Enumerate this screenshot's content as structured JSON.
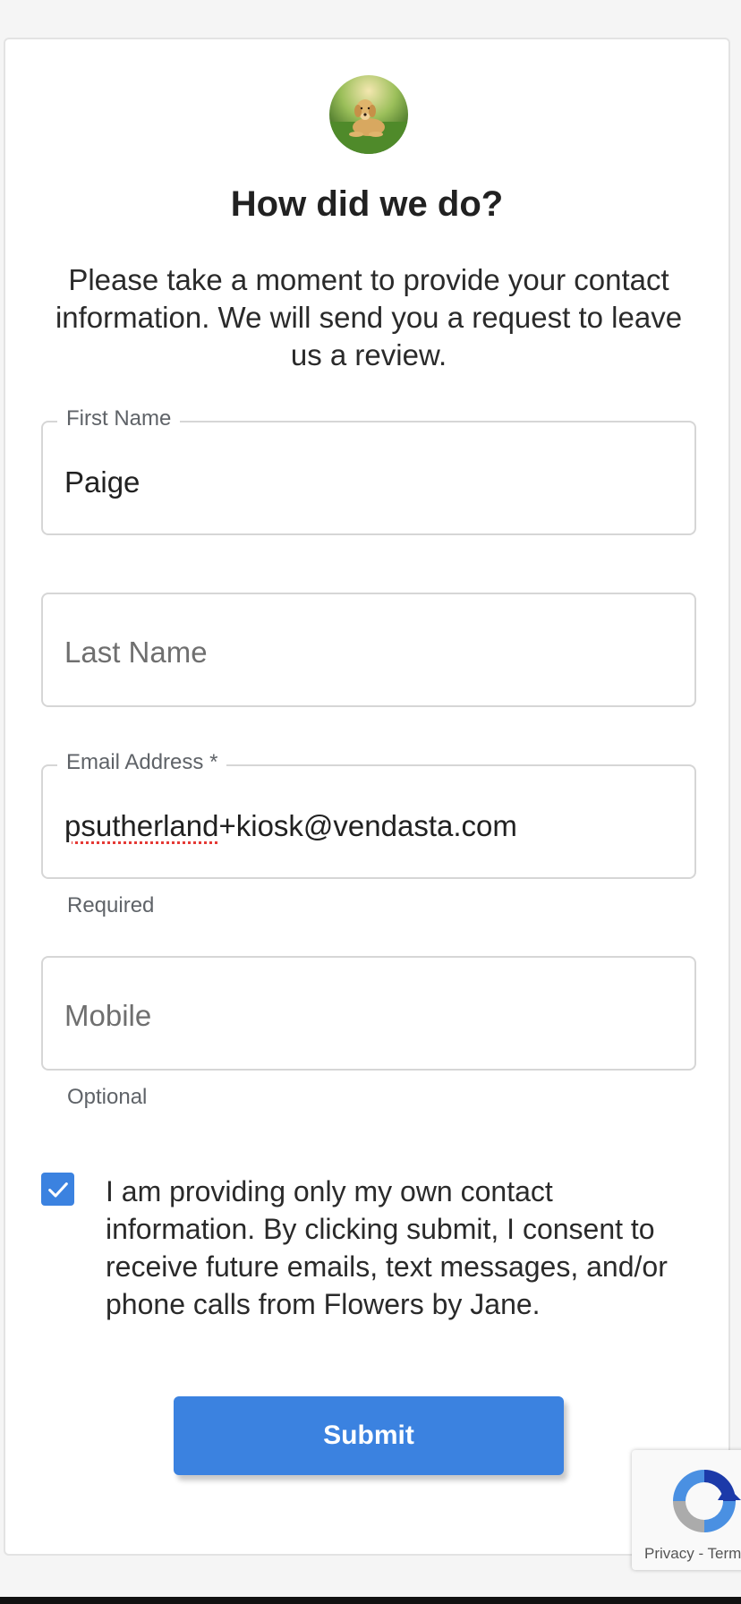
{
  "header": {
    "avatar_icon": "dog-photo-avatar",
    "title": "How did we do?",
    "intro": "Please take a moment to provide your contact information. We will send you a request to leave us a review."
  },
  "form": {
    "first_name": {
      "label": "First Name",
      "value": "Paige"
    },
    "last_name": {
      "placeholder": "Last Name",
      "value": ""
    },
    "email": {
      "label": "Email Address *",
      "value_misspelled": "psutherland",
      "value_rest": "+kiosk@vendasta.com",
      "hint": "Required"
    },
    "mobile": {
      "placeholder": "Mobile",
      "value": "",
      "hint": "Optional"
    },
    "consent": {
      "checked": true,
      "text": "I am providing only my own contact information. By clicking submit, I consent to receive future emails, text messages, and/or phone calls from Flowers by Jane."
    },
    "submit_label": "Submit"
  },
  "recaptcha": {
    "links": "Privacy - Terms"
  },
  "colors": {
    "accent": "#3b82e0",
    "border": "#d6d6d6",
    "hint": "#5f6368"
  }
}
